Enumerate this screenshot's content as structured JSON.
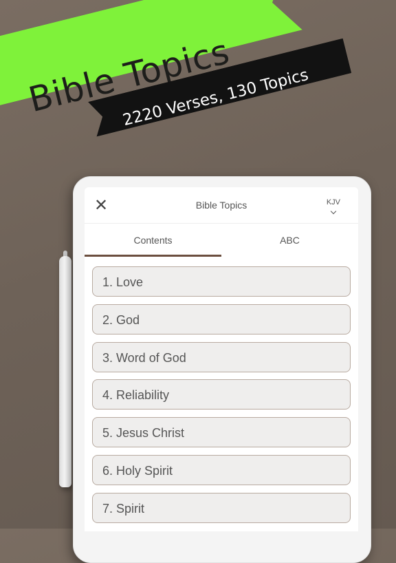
{
  "banner": {
    "title": "Bible Topics",
    "subtitle": "2220 Verses, 130 Topics"
  },
  "app": {
    "title": "Bible Topics",
    "version": "KJV",
    "tabs": [
      "Contents",
      "ABC"
    ],
    "active_tab": "Contents",
    "topics": [
      "1. Love",
      "2. God",
      "3. Word of God",
      "4. Reliability",
      "5. Jesus Christ",
      "6. Holy Spirit",
      "7. Spirit"
    ]
  },
  "icons": {
    "close": "close-icon",
    "version_dropdown": "chevron-down-icon"
  },
  "colors": {
    "banner_green": "#7ff23a",
    "banner_black": "#121212",
    "background": "#6e6258",
    "tab_indicator": "#6b4e3f",
    "item_border": "#b8aaa0"
  }
}
